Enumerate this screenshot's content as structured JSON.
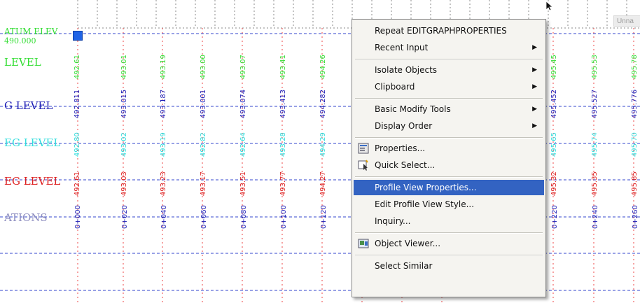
{
  "rows": [
    {
      "label_top": "ATUM ELEV",
      "label_sub": "490.000",
      "label": "LEVEL",
      "color": "#33dd33",
      "values": [
        "492.61",
        "493.01",
        "493.19",
        "493.00",
        "493.07",
        "493.41",
        "494.26",
        "",
        "",
        "",
        "495.45",
        "495.53",
        "495.78"
      ]
    },
    {
      "label": "G LEVEL",
      "color": "#1a1ab3",
      "values": [
        "492.811",
        "493.015",
        "493.187",
        "493.001",
        "493.074",
        "493.413",
        "494.282",
        "",
        "",
        "",
        "495.452",
        "495.527",
        "495.776"
      ]
    },
    {
      "label": "EG LEVEL",
      "color": "#33dddd",
      "values": [
        "492.80",
        "493.02",
        "493.19",
        "492.82",
        "492.64",
        "493.28",
        "494.29",
        "",
        "",
        "",
        "495.65",
        "495.74",
        "495.70"
      ]
    },
    {
      "label": "EG LEVEL",
      "color": "#dd1f1f",
      "values": [
        "492.61",
        "493.03",
        "493.23",
        "493.17",
        "493.51",
        "493.77",
        "494.27",
        "",
        "",
        "",
        "495.32",
        "495.35",
        "495.85"
      ]
    },
    {
      "label": "ATIONS",
      "color": "#1a1ab3",
      "values": [
        "0+000",
        "0+020",
        "0+040",
        "0+060",
        "0+080",
        "0+100",
        "0+120",
        "",
        "",
        "",
        "0+220",
        "0+240",
        "0+260"
      ]
    }
  ],
  "row_label_colors": [
    "#33dd33",
    "#1a1ab3",
    "#33dddd",
    "#dd1f1f",
    "#8c8cbf"
  ],
  "tab_label": "Unna",
  "menu": {
    "items": [
      {
        "label": "Repeat EDITGRAPHPROPERTIES",
        "submenu": false,
        "icon": ""
      },
      {
        "label": "Recent Input",
        "submenu": true,
        "icon": ""
      },
      {
        "sep": true
      },
      {
        "label": "Isolate Objects",
        "submenu": true,
        "icon": ""
      },
      {
        "label": "Clipboard",
        "submenu": true,
        "icon": ""
      },
      {
        "sep": true
      },
      {
        "label": "Basic Modify Tools",
        "submenu": true,
        "icon": ""
      },
      {
        "label": "Display Order",
        "submenu": true,
        "icon": ""
      },
      {
        "sep": true
      },
      {
        "label": "Properties...",
        "submenu": false,
        "icon": "properties-icon"
      },
      {
        "label": "Quick Select...",
        "submenu": false,
        "icon": "quick-select-icon"
      },
      {
        "sep": true
      },
      {
        "label": "Profile View Properties...",
        "submenu": false,
        "icon": "",
        "highlight": true
      },
      {
        "label": "Edit Profile View Style...",
        "submenu": false,
        "icon": ""
      },
      {
        "label": "Inquiry...",
        "submenu": false,
        "icon": ""
      },
      {
        "sep": true
      },
      {
        "label": "Object Viewer...",
        "submenu": false,
        "icon": "object-viewer-icon"
      },
      {
        "sep": true
      },
      {
        "label": "Select Similar",
        "submenu": false,
        "icon": ""
      }
    ]
  },
  "colors": {
    "grid_dash": "#3344cc",
    "grid_tick": "#e44",
    "highlight": "#3363c2"
  }
}
